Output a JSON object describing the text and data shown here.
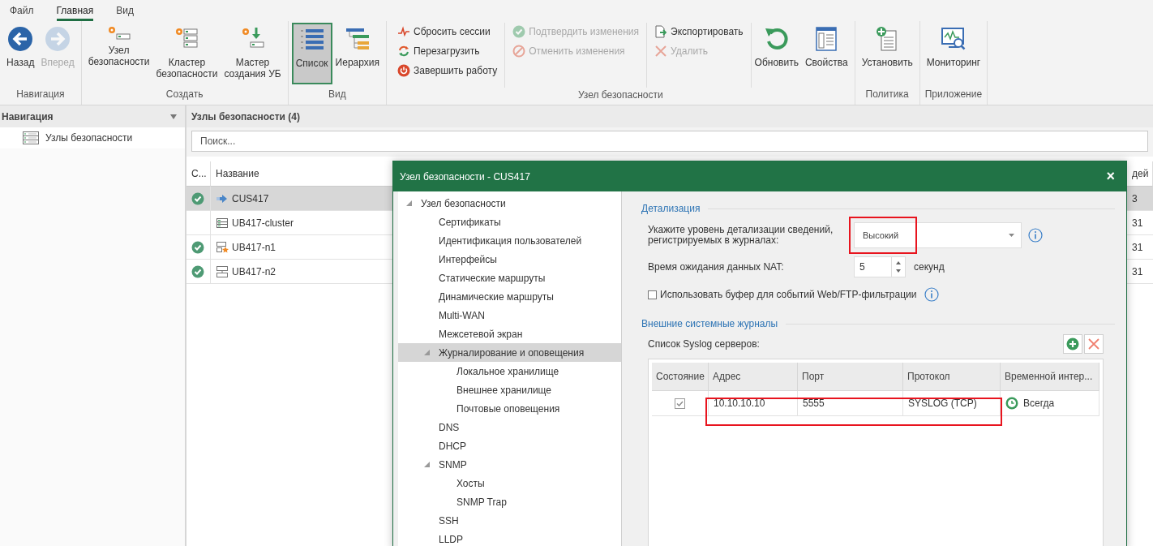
{
  "ribbon": {
    "tabs": [
      {
        "label": "Файл",
        "selected": false
      },
      {
        "label": "Главная",
        "selected": true
      },
      {
        "label": "Вид",
        "selected": false
      }
    ],
    "groups": [
      {
        "label": "Навигация",
        "items": [
          {
            "kind": "large",
            "label": "Назад",
            "disabled": false
          },
          {
            "kind": "large",
            "label": "Вперед",
            "disabled": true
          }
        ]
      },
      {
        "label": "Создать",
        "items": [
          {
            "kind": "large",
            "label": "Узел\nбезопасности",
            "disabled": false
          },
          {
            "kind": "large",
            "label": "Кластер\nбезопасности",
            "disabled": false
          },
          {
            "kind": "large",
            "label": "Мастер\nсоздания УБ",
            "disabled": false
          }
        ]
      },
      {
        "label": "Вид",
        "items": [
          {
            "kind": "large",
            "label": "Список",
            "disabled": false,
            "selected": true
          },
          {
            "kind": "large",
            "label": "Иерархия",
            "disabled": false,
            "selected": false
          }
        ]
      },
      {
        "label": "Узел безопасности",
        "items": [
          {
            "kind": "stack",
            "buttons": [
              {
                "label": "Сбросить сессии",
                "disabled": false
              },
              {
                "label": "Перезагрузить",
                "disabled": false
              },
              {
                "label": "Завершить работу",
                "disabled": false
              }
            ]
          },
          {
            "kind": "stack",
            "buttons": [
              {
                "label": "Подтвердить изменения",
                "disabled": true
              },
              {
                "label": "Отменить изменения",
                "disabled": true
              }
            ]
          },
          {
            "kind": "stack",
            "buttons": [
              {
                "label": "Экспортировать",
                "disabled": false
              },
              {
                "label": "Удалить",
                "disabled": true
              }
            ]
          },
          {
            "kind": "large",
            "label": "Обновить",
            "disabled": false
          },
          {
            "kind": "large",
            "label": "Свойства",
            "disabled": false
          }
        ]
      },
      {
        "label": "Политика",
        "items": [
          {
            "kind": "large",
            "label": "Установить",
            "disabled": false
          }
        ]
      },
      {
        "label": "Приложение",
        "items": [
          {
            "kind": "large",
            "label": "Мониторинг",
            "disabled": false
          }
        ]
      }
    ]
  },
  "navigation": {
    "title": "Навигация",
    "items": [
      {
        "label": "Узлы безопасности"
      }
    ]
  },
  "node_list": {
    "title": "Узлы безопасности (4)",
    "search": {
      "placeholder": "Поиск..."
    },
    "columns": [
      "С...",
      "Название",
      "дей"
    ],
    "rows": [
      {
        "verified": true,
        "kind": "link",
        "name": "CUS417",
        "column_3": "3",
        "selected": true
      },
      {
        "verified": false,
        "kind": "cluster",
        "name": "UB417-cluster",
        "column_3": "31",
        "selected": false
      },
      {
        "verified": true,
        "kind": "master",
        "name": "UB417-n1",
        "column_3": "31",
        "selected": false
      },
      {
        "verified": true,
        "kind": "node",
        "name": "UB417-n2",
        "column_3": "31",
        "selected": false
      }
    ]
  },
  "dialog": {
    "title": "Узел безопасности - CUS417",
    "close": "×",
    "tree": [
      {
        "label": "Узел безопасности",
        "expanded": true,
        "selected": false,
        "children": [
          {
            "label": "Сертификаты",
            "selected": false
          },
          {
            "label": "Идентификация пользователей",
            "selected": false
          },
          {
            "label": "Интерфейсы",
            "selected": false
          },
          {
            "label": "Статические маршруты",
            "selected": false
          },
          {
            "label": "Динамические маршруты",
            "selected": false
          },
          {
            "label": "Multi-WAN",
            "selected": false
          },
          {
            "label": "Межсетевой экран",
            "selected": false
          },
          {
            "label": "Журналирование и оповещения",
            "expanded": true,
            "selected": true,
            "children": [
              {
                "label": "Локальное хранилище",
                "selected": false
              },
              {
                "label": "Внешнее хранилище",
                "selected": false
              },
              {
                "label": "Почтовые оповещения",
                "selected": false
              }
            ]
          },
          {
            "label": "DNS",
            "selected": false
          },
          {
            "label": "DHCP",
            "selected": false
          },
          {
            "label": "SNMP",
            "expanded": true,
            "selected": false,
            "children": [
              {
                "label": "Хосты",
                "selected": false
              },
              {
                "label": "SNMP Trap",
                "selected": false
              }
            ]
          },
          {
            "label": "SSH",
            "selected": false
          },
          {
            "label": "LLDP",
            "selected": false
          }
        ]
      }
    ],
    "detail": {
      "heading": "Детализация",
      "level_label": "Укажите уровень детализации сведений,\nрегистрируемых в журналах:",
      "level_value": "Высокий",
      "level_highlighted": true,
      "nat_label": "Время ожидания данных NAT:",
      "nat_value": "5",
      "nat_unit": "секунд",
      "buffer_label": "Использовать буфер для событий Web/FTP-фильтрации",
      "buffer_checked": false
    },
    "syslog": {
      "heading": "Внешние системные журналы",
      "list_label": "Список Syslog серверов:",
      "columns": [
        "Состояние",
        "Адрес",
        "Порт",
        "Протокол",
        "Временной интер..."
      ],
      "rows": [
        {
          "enabled": true,
          "address": "10.10.10.10",
          "port": "5555",
          "protocol": "SYSLOG (TCP)",
          "schedule": "Всегда",
          "highlighted": true
        }
      ]
    }
  }
}
